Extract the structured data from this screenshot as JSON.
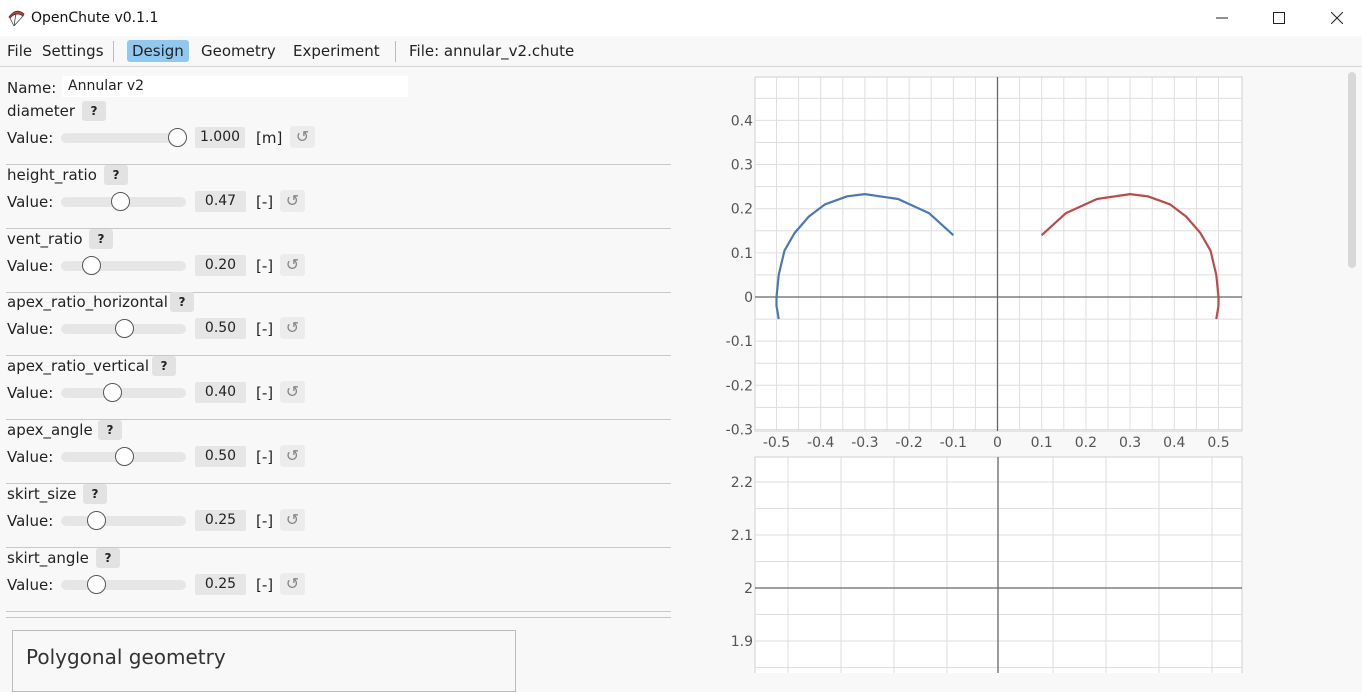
{
  "window": {
    "title": "OpenChute v0.1.1"
  },
  "menu": {
    "file": "File",
    "settings": "Settings",
    "design": "Design",
    "geometry": "Geometry",
    "experiment": "Experiment",
    "file_info": "File: annular_v2.chute"
  },
  "design": {
    "name_label": "Name:",
    "name_value": "Annular v2",
    "value_label": "Value:",
    "help_label": "?",
    "reset_icon": "↺",
    "params": [
      {
        "name": "diameter",
        "value": "1.000",
        "unit": "[m]",
        "slider": 0.93
      },
      {
        "name": "height_ratio",
        "value": "0.47",
        "unit": "[-]",
        "slider": 0.47
      },
      {
        "name": "vent_ratio",
        "value": "0.20",
        "unit": "[-]",
        "slider": 0.24
      },
      {
        "name": "apex_ratio_horizontal",
        "value": "0.50",
        "unit": "[-]",
        "slider": 0.5
      },
      {
        "name": "apex_ratio_vertical",
        "value": "0.40",
        "unit": "[-]",
        "slider": 0.41
      },
      {
        "name": "apex_angle",
        "value": "0.50",
        "unit": "[-]",
        "slider": 0.5
      },
      {
        "name": "skirt_size",
        "value": "0.25",
        "unit": "[-]",
        "slider": 0.28
      },
      {
        "name": "skirt_angle",
        "value": "0.25",
        "unit": "[-]",
        "slider": 0.28
      }
    ],
    "polygonal_title": "Polygonal geometry"
  },
  "chart_data": [
    {
      "type": "line",
      "xlim": [
        -0.5,
        0.5
      ],
      "ylim": [
        -0.3,
        0.45
      ],
      "x_ticks": [
        "-0.5",
        "-0.4",
        "-0.3",
        "-0.2",
        "-0.1",
        "0",
        "0.1",
        "0.2",
        "0.3",
        "0.4",
        "0.5"
      ],
      "y_ticks": [
        "0.4",
        "0.3",
        "0.2",
        "0.1",
        "0",
        "-0.1",
        "-0.2",
        "-0.3"
      ],
      "grid": true,
      "series": [
        {
          "color": "#4c78b0",
          "x": [
            -0.1,
            -0.155,
            -0.225,
            -0.3,
            -0.34,
            -0.39,
            -0.427,
            -0.459,
            -0.482,
            -0.495,
            -0.5,
            -0.5,
            -0.495
          ],
          "y": [
            0.14,
            0.19,
            0.222,
            0.233,
            0.228,
            0.21,
            0.182,
            0.145,
            0.105,
            0.05,
            0.0,
            -0.02,
            -0.05
          ]
        },
        {
          "color": "#b84b4b",
          "x": [
            0.1,
            0.155,
            0.225,
            0.3,
            0.34,
            0.39,
            0.427,
            0.459,
            0.482,
            0.495,
            0.5,
            0.5,
            0.495
          ],
          "y": [
            0.14,
            0.19,
            0.222,
            0.233,
            0.228,
            0.21,
            0.182,
            0.145,
            0.105,
            0.05,
            0.0,
            -0.02,
            -0.05
          ]
        }
      ]
    },
    {
      "type": "line",
      "ylim": [
        1.85,
        2.25
      ],
      "y_ticks": [
        "2.2",
        "2.1",
        "2",
        "1.9"
      ],
      "grid": true,
      "series": []
    }
  ]
}
